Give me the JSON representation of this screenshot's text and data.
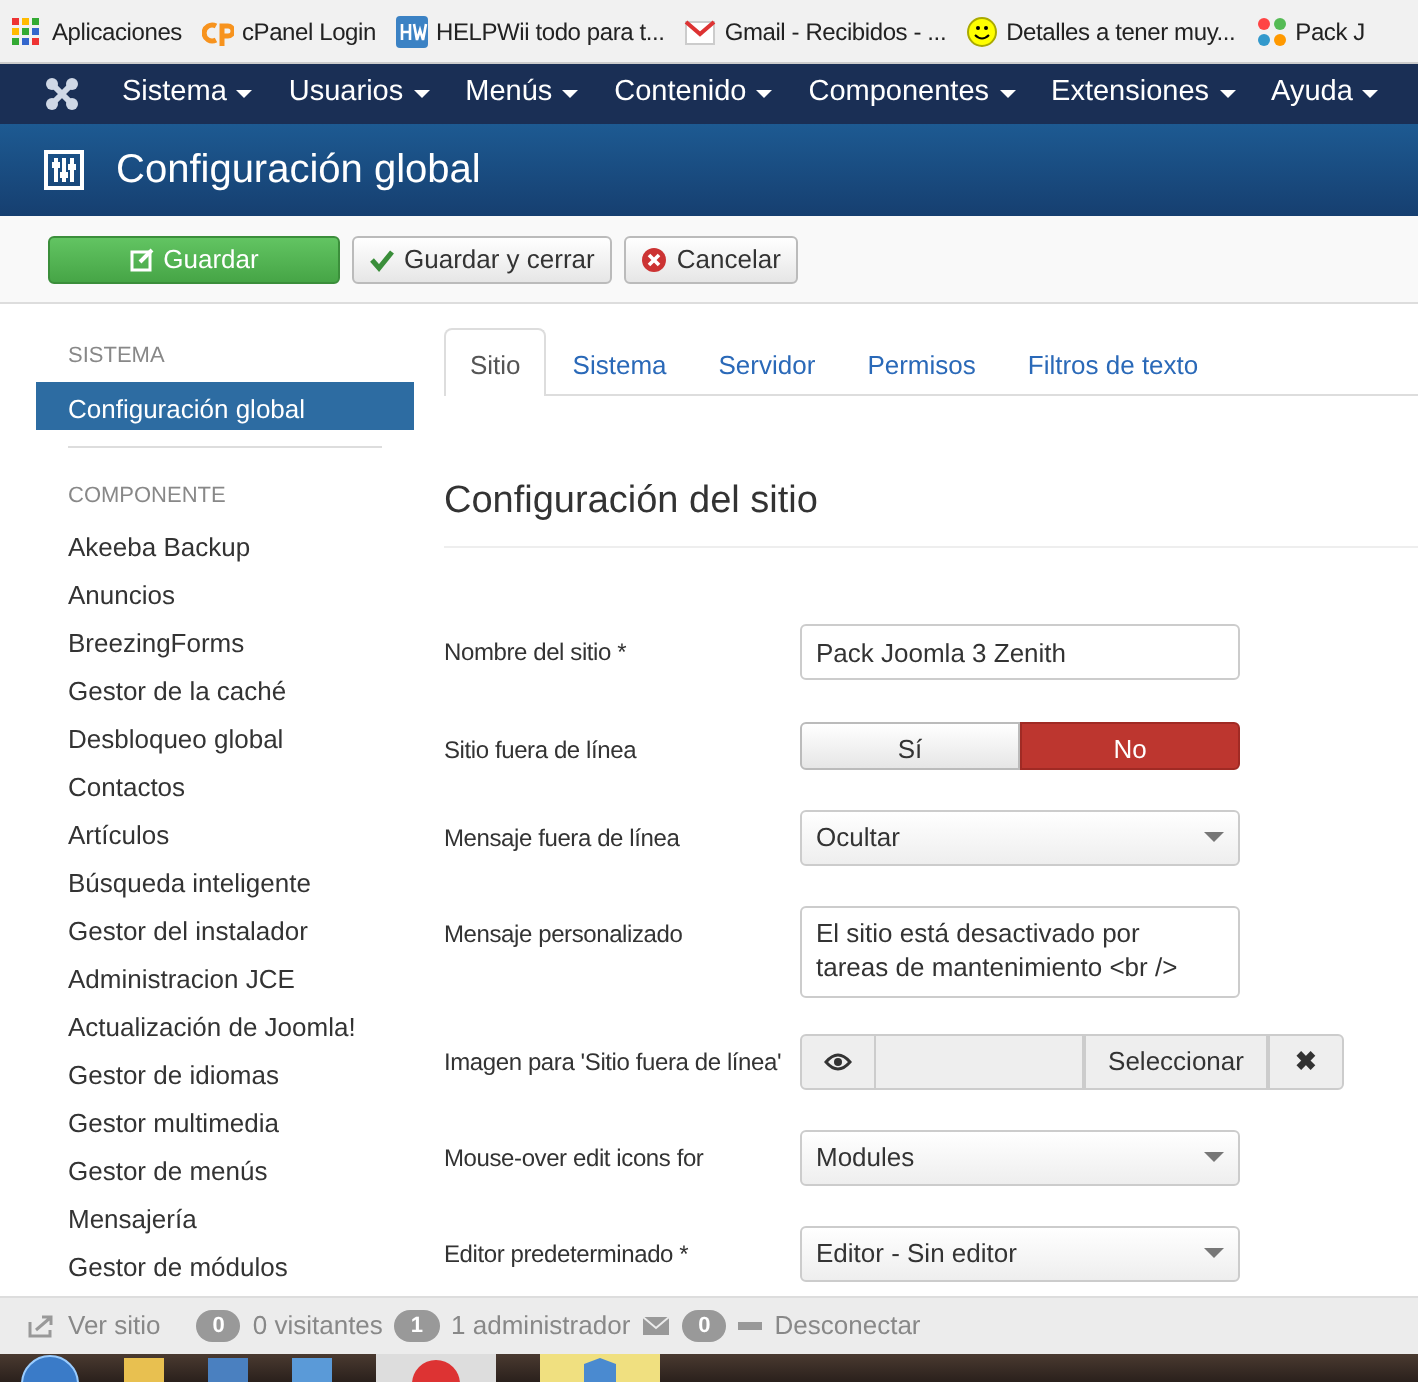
{
  "bookmarks": [
    {
      "label": "Aplicaciones"
    },
    {
      "label": "cPanel Login"
    },
    {
      "label": "HELPWii todo para t..."
    },
    {
      "label": "Gmail - Recibidos - ..."
    },
    {
      "label": "Detalles a tener muy..."
    },
    {
      "label": "Pack J"
    }
  ],
  "menu": [
    {
      "label": "Sistema"
    },
    {
      "label": "Usuarios"
    },
    {
      "label": "Menús"
    },
    {
      "label": "Contenido"
    },
    {
      "label": "Componentes"
    },
    {
      "label": "Extensiones"
    },
    {
      "label": "Ayuda"
    }
  ],
  "page_title": "Configuración global",
  "toolbar": [
    {
      "label": "Guardar",
      "kind": "primary"
    },
    {
      "label": "Guardar y cerrar",
      "kind": "check"
    },
    {
      "label": "Cancelar",
      "kind": "cancel"
    }
  ],
  "sidebar": [
    {
      "heading": "SISTEMA",
      "items": [
        {
          "label": "Configuración global",
          "selected": true
        }
      ]
    },
    {
      "heading": "COMPONENTE",
      "items": [
        {
          "label": "Akeeba Backup",
          "selected": false
        },
        {
          "label": "Anuncios",
          "selected": false
        },
        {
          "label": "BreezingForms",
          "selected": false
        },
        {
          "label": "Gestor de la caché",
          "selected": false
        },
        {
          "label": "Desbloqueo global",
          "selected": false
        },
        {
          "label": "Contactos",
          "selected": false
        },
        {
          "label": "Artículos",
          "selected": false
        },
        {
          "label": "Búsqueda inteligente",
          "selected": false
        },
        {
          "label": "Gestor del instalador",
          "selected": false
        },
        {
          "label": "Administracion JCE",
          "selected": false
        },
        {
          "label": "Actualización de Joomla!",
          "selected": false
        },
        {
          "label": "Gestor de idiomas",
          "selected": false
        },
        {
          "label": "Gestor multimedia",
          "selected": false
        },
        {
          "label": "Gestor de menús",
          "selected": false
        },
        {
          "label": "Mensajería",
          "selected": false
        },
        {
          "label": "Gestor de módulos",
          "selected": false
        }
      ]
    }
  ],
  "tabs": [
    {
      "label": "Sitio",
      "selected": true
    },
    {
      "label": "Sistema",
      "selected": false
    },
    {
      "label": "Servidor",
      "selected": false
    },
    {
      "label": "Permisos",
      "selected": false
    },
    {
      "label": "Filtros de texto",
      "selected": false
    }
  ],
  "section_title": "Configuración del sitio",
  "fields": [
    {
      "kind": "text",
      "label": "Nombre del sitio *",
      "value": "Pack Joomla 3 Zenith"
    },
    {
      "kind": "toggle",
      "label": "Sitio fuera de línea",
      "options": [
        {
          "label": "Sí",
          "selected": false
        },
        {
          "label": "No",
          "selected": true
        }
      ]
    },
    {
      "kind": "select",
      "label": "Mensaje fuera de línea",
      "value": "Ocultar"
    },
    {
      "kind": "textarea",
      "label": "Mensaje personalizado",
      "value": "El sitio está desactivado por tareas de mantenimiento <br />"
    },
    {
      "kind": "media",
      "label": "Imagen para 'Sitio fuera de línea'",
      "button": "Seleccionar",
      "clear": "✖"
    },
    {
      "kind": "select",
      "label": "Mouse-over edit icons for",
      "value": "Modules"
    },
    {
      "kind": "select",
      "label": "Editor predeterminado *",
      "value": "Editor - Sin editor"
    }
  ],
  "status_bar": [
    {
      "kind": "link",
      "label": "Ver sitio"
    },
    {
      "kind": "count",
      "count": "0",
      "label": "0 visitantes"
    },
    {
      "kind": "count",
      "count": "1",
      "label": "1 administrador"
    },
    {
      "kind": "mailcount",
      "count": "0"
    },
    {
      "kind": "logout",
      "label": "Desconectar"
    }
  ]
}
